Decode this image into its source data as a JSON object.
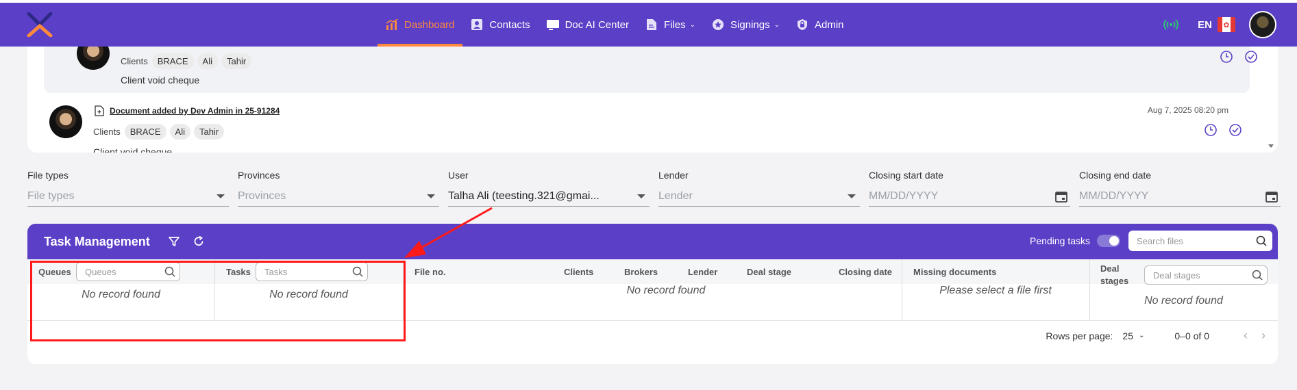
{
  "colors": {
    "brand": "#5b3fc7",
    "accent": "#ff8a3d",
    "annotation": "#ff1a1a"
  },
  "nav": {
    "items": [
      {
        "label": "Dashboard",
        "icon": "chart-icon",
        "active": true
      },
      {
        "label": "Contacts",
        "icon": "contact-card-icon"
      },
      {
        "label": "Doc AI Center",
        "icon": "screen-icon"
      },
      {
        "label": "Files",
        "icon": "file-icon",
        "dropdown": true
      },
      {
        "label": "Signings",
        "icon": "star-badge-icon",
        "dropdown": true
      },
      {
        "label": "Admin",
        "icon": "lock-icon"
      }
    ],
    "lang": "EN"
  },
  "activity": {
    "items": [
      {
        "clients_label": "Clients",
        "chips": [
          "BRACE",
          "Ali",
          "Tahir"
        ],
        "note": "Client void cheque"
      },
      {
        "title": "Document added by Dev Admin in 25-91284",
        "date": "Aug 7, 2025 08:20 pm",
        "clients_label": "Clients",
        "chips": [
          "BRACE",
          "Ali",
          "Tahir"
        ],
        "note": "Client void cheque"
      }
    ]
  },
  "filters": {
    "file_types": {
      "label": "File types",
      "placeholder": "File types"
    },
    "provinces": {
      "label": "Provinces",
      "placeholder": "Provinces"
    },
    "user": {
      "label": "User",
      "value": "Talha Ali (teesting.321@gmai..."
    },
    "lender": {
      "label": "Lender",
      "placeholder": "Lender"
    },
    "closing_start": {
      "label": "Closing start date",
      "placeholder": "MM/DD/YYYY"
    },
    "closing_end": {
      "label": "Closing end date",
      "placeholder": "MM/DD/YYYY"
    }
  },
  "tasks": {
    "title": "Task Management",
    "pending_label": "Pending tasks",
    "search_placeholder": "Search files",
    "queues_label": "Queues",
    "queues_placeholder": "Queues",
    "tasks_label": "Tasks",
    "tasks_placeholder": "Tasks",
    "columns": [
      "File no.",
      "Clients",
      "Brokers",
      "Lender",
      "Deal stage",
      "Closing date"
    ],
    "missing_docs_label": "Missing documents",
    "deal_stages_label_1": "Deal",
    "deal_stages_label_2": "stages",
    "deal_stages_placeholder": "Deal stages",
    "no_record": "No record found",
    "select_file": "Please select a file first",
    "rows_per_page_label": "Rows per page:",
    "rows_per_page": "25",
    "range": "0–0 of 0"
  }
}
